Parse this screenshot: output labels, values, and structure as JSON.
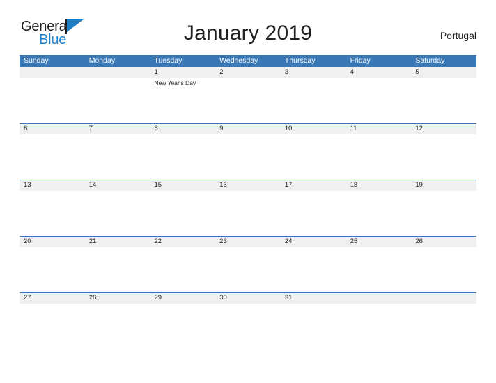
{
  "logo": {
    "word_one": "General",
    "word_two": "Blue",
    "flag_icon": "flag-triangle-icon",
    "color_dark": "#231f20",
    "color_blue": "#1f7fc4"
  },
  "header": {
    "title": "January 2019",
    "region": "Portugal"
  },
  "theme": {
    "header_blue": "#3a78b5",
    "band_gray": "#f0f0f0",
    "text_dark": "#231f20",
    "page_background": "#ffffff"
  },
  "calendar": {
    "month": "January",
    "year": "2019",
    "weekday_headers": [
      "Sunday",
      "Monday",
      "Tuesday",
      "Wednesday",
      "Thursday",
      "Friday",
      "Saturday"
    ],
    "weeks": [
      [
        {
          "day": "",
          "events": []
        },
        {
          "day": "",
          "events": []
        },
        {
          "day": "1",
          "events": [
            "New Year's Day"
          ]
        },
        {
          "day": "2",
          "events": []
        },
        {
          "day": "3",
          "events": []
        },
        {
          "day": "4",
          "events": []
        },
        {
          "day": "5",
          "events": []
        }
      ],
      [
        {
          "day": "6",
          "events": []
        },
        {
          "day": "7",
          "events": []
        },
        {
          "day": "8",
          "events": []
        },
        {
          "day": "9",
          "events": []
        },
        {
          "day": "10",
          "events": []
        },
        {
          "day": "11",
          "events": []
        },
        {
          "day": "12",
          "events": []
        }
      ],
      [
        {
          "day": "13",
          "events": []
        },
        {
          "day": "14",
          "events": []
        },
        {
          "day": "15",
          "events": []
        },
        {
          "day": "16",
          "events": []
        },
        {
          "day": "17",
          "events": []
        },
        {
          "day": "18",
          "events": []
        },
        {
          "day": "19",
          "events": []
        }
      ],
      [
        {
          "day": "20",
          "events": []
        },
        {
          "day": "21",
          "events": []
        },
        {
          "day": "22",
          "events": []
        },
        {
          "day": "23",
          "events": []
        },
        {
          "day": "24",
          "events": []
        },
        {
          "day": "25",
          "events": []
        },
        {
          "day": "26",
          "events": []
        }
      ],
      [
        {
          "day": "27",
          "events": []
        },
        {
          "day": "28",
          "events": []
        },
        {
          "day": "29",
          "events": []
        },
        {
          "day": "30",
          "events": []
        },
        {
          "day": "31",
          "events": []
        },
        {
          "day": "",
          "events": []
        },
        {
          "day": "",
          "events": []
        }
      ]
    ]
  }
}
